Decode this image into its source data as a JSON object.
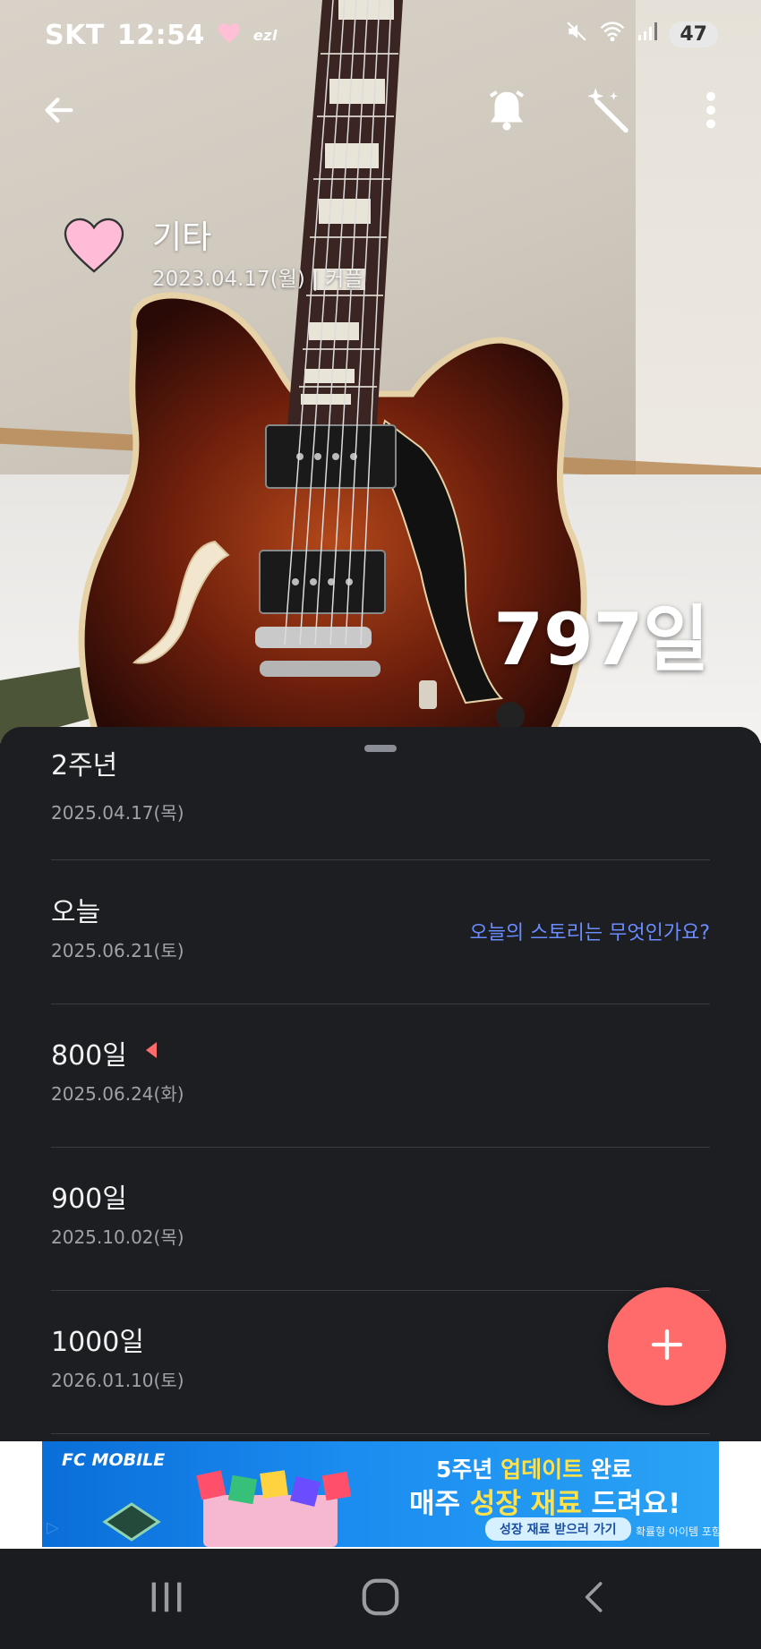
{
  "status_bar": {
    "carrier": "SKT",
    "time": "12:54",
    "extra_label": "ezl",
    "battery": "47"
  },
  "header": {
    "back_icon": "back-arrow-icon",
    "alarm_icon": "bell-icon",
    "magic_icon": "magic-wand-icon",
    "more_icon": "more-vert-icon"
  },
  "anniversary": {
    "title": "기타",
    "subtitle": "2023.04.17(월)  |  커플",
    "day_count": "797일"
  },
  "list": {
    "items": [
      {
        "name": "2주년",
        "date": "2025.04.17(목)"
      },
      {
        "name": "오늘",
        "date": "2025.06.21(토)",
        "link": "오늘의 스토리는 무엇인가요?"
      },
      {
        "name": "800일",
        "date": "2025.06.24(화)"
      },
      {
        "name": "900일",
        "date": "2025.10.02(목)"
      },
      {
        "name": "1000일",
        "date": "2026.01.10(토)"
      }
    ]
  },
  "fab": {
    "icon": "plus-icon"
  },
  "ad": {
    "brand": "FC MOBILE",
    "headline_1_pre": "5주년 ",
    "headline_1_hl": "업데이트",
    "headline_1_post": " 완료",
    "headline_2_pre": "매주 ",
    "headline_2_hl": "성장 재료",
    "headline_2_post": " 드려요!",
    "cta": "성장 재료 받으러 가기",
    "note": "확률형 아이템 포함"
  },
  "colors": {
    "accent": "#ff6b6b",
    "link": "#6b8cff",
    "sheet_bg": "#1c1e22"
  }
}
